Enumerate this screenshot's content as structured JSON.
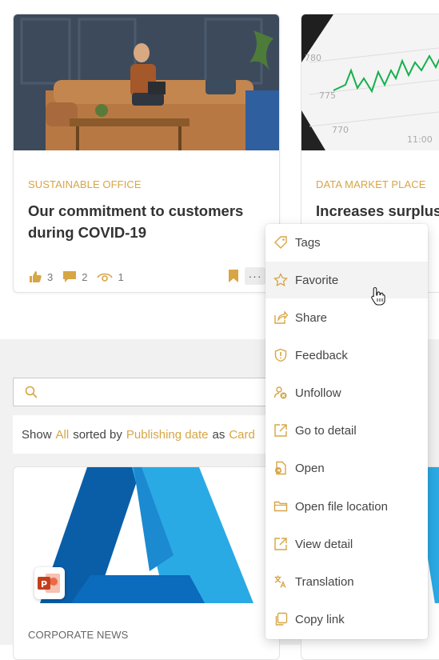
{
  "cards": [
    {
      "category": "SUSTAINABLE OFFICE",
      "title": "Our commitment to customers during COVID-19",
      "likes": "3",
      "comments": "2",
      "views": "1"
    },
    {
      "category": "DATA MARKET PLACE",
      "title": "Increases surplus"
    },
    {
      "category": "CORPORATE NEWS"
    }
  ],
  "chart_thumb": {
    "labels": [
      "780",
      "775",
      "770",
      "11:00"
    ]
  },
  "search": {
    "placeholder": ""
  },
  "showbar": {
    "show": "Show",
    "all": "All",
    "sorted_by": "sorted by",
    "sort_field": "Publishing date",
    "as": "as",
    "view": "Card"
  },
  "menu": {
    "items": [
      {
        "label": "Tags",
        "icon": "tag-icon"
      },
      {
        "label": "Favorite",
        "icon": "star-icon"
      },
      {
        "label": "Share",
        "icon": "share-icon"
      },
      {
        "label": "Feedback",
        "icon": "shield-exclamation-icon"
      },
      {
        "label": "Unfollow",
        "icon": "unfollow-icon"
      },
      {
        "label": "Go to detail",
        "icon": "external-link-icon"
      },
      {
        "label": "Open",
        "icon": "open-file-icon"
      },
      {
        "label": "Open file location",
        "icon": "folder-icon"
      },
      {
        "label": "View detail",
        "icon": "external-link-icon"
      },
      {
        "label": "Translation",
        "icon": "translate-icon"
      },
      {
        "label": "Copy link",
        "icon": "copy-icon"
      }
    ]
  },
  "colors": {
    "accent": "#d7a545",
    "text": "#333333",
    "bandBg": "#f1f1f1"
  }
}
